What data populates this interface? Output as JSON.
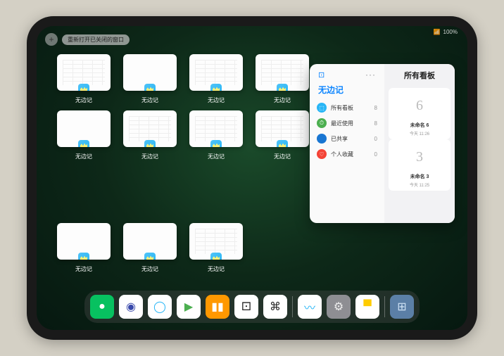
{
  "status": {
    "wifi": "📶",
    "battery": "100%"
  },
  "top": {
    "add": "+",
    "reopen": "重新打开已关闭的窗口"
  },
  "app_label": "无边记",
  "thumb_count": 11,
  "thumb_layout": [
    "lines",
    "white",
    "lines",
    "lines",
    "white",
    "lines",
    "lines",
    "lines",
    "white",
    "white",
    "lines"
  ],
  "popover": {
    "back_glyph": "⊡",
    "more": "···",
    "title": "无边记",
    "right_title": "所有看板",
    "items": [
      {
        "icon_color": "#29b6f6",
        "glyph": "⬚",
        "label": "所有看板",
        "count": 8
      },
      {
        "icon_color": "#4caf50",
        "glyph": "⏱",
        "label": "最近使用",
        "count": 8
      },
      {
        "icon_color": "#1976d2",
        "glyph": "👤",
        "label": "已共享",
        "count": 0
      },
      {
        "icon_color": "#f44336",
        "glyph": "♡",
        "label": "个人收藏",
        "count": 0
      }
    ],
    "boards": [
      {
        "sketch": "6",
        "name": "未命名 6",
        "sub": "今天 11:26"
      },
      {
        "sketch": "3",
        "name": "未命名 3",
        "sub": "今天 11:25"
      }
    ]
  },
  "dock": [
    {
      "name": "wechat",
      "bg": "#07c160",
      "glyph": "●",
      "fg": "#fff"
    },
    {
      "name": "quark-hd",
      "bg": "#ffffff",
      "glyph": "◉",
      "fg": "#3949ab"
    },
    {
      "name": "quark",
      "bg": "#ffffff",
      "glyph": "◯",
      "fg": "#29b6f6"
    },
    {
      "name": "media",
      "bg": "#ffffff",
      "glyph": "▶",
      "fg": "#4caf50"
    },
    {
      "name": "books",
      "bg": "#ff9800",
      "glyph": "▮▮",
      "fg": "#fff"
    },
    {
      "name": "app6",
      "bg": "#ffffff",
      "glyph": "⚀",
      "fg": "#222"
    },
    {
      "name": "app7",
      "bg": "#ffffff",
      "glyph": "⌘",
      "fg": "#222"
    },
    {
      "name": "freeform",
      "bg": "#ffffff",
      "glyph": "〰",
      "fg": "#29b6f6"
    },
    {
      "name": "settings",
      "bg": "#8e8e93",
      "glyph": "⚙",
      "fg": "#eee"
    },
    {
      "name": "notes",
      "bg": "#ffffff",
      "glyph": "▀",
      "fg": "#ffcc00"
    },
    {
      "name": "app-library",
      "bg": "#5b7fa6",
      "glyph": "⊞",
      "fg": "#cfe3f5"
    }
  ]
}
